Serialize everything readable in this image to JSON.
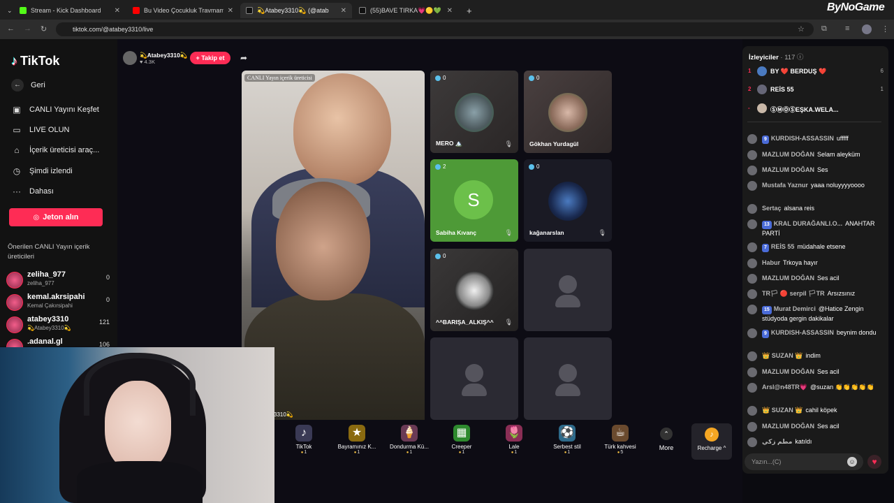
{
  "browser": {
    "tabs": [
      {
        "title": "Stream - Kick Dashboard",
        "favicon_color": "#53fc18"
      },
      {
        "title": "Bu Video Çocukluk Travmamdı",
        "favicon_color": "#ff0000"
      },
      {
        "title": "💫Atabey3310💫 (@atab",
        "favicon_color": "#111111"
      },
      {
        "title": "(55)BAVE TIRKA💗🟡💚 (@k.c",
        "favicon_color": "#111111"
      }
    ],
    "url": "tiktok.com/@atabey3310/live",
    "watermark": "ByNoGame"
  },
  "sidebar": {
    "logo": "TikTok",
    "back": "Geri",
    "items": [
      {
        "label": "CANLI Yayını Keşfet",
        "icon": "tv-icon"
      },
      {
        "label": "LIVE OLUN",
        "icon": "camera-icon"
      },
      {
        "label": "İçerik üreticisi araç...",
        "icon": "home-icon"
      },
      {
        "label": "Şimdi izlendi",
        "icon": "history-icon"
      },
      {
        "label": "Dahası",
        "icon": "more-icon"
      }
    ],
    "jeton_button": "Jeton alın",
    "suggest_title": "Önerilen CANLI Yayın içerik üreticileri",
    "suggestions": [
      {
        "name": "zeliha_977",
        "sub": "zeliha_977",
        "count": "0"
      },
      {
        "name": "kemal.akrsipahi",
        "sub": "Kemal Çakırsipahi",
        "count": "0"
      },
      {
        "name": "atabey3310",
        "sub": "💫Atabey3310💫",
        "count": "121"
      },
      {
        "name": ".adanal.gl",
        "sub": "",
        "count": "106"
      }
    ]
  },
  "live": {
    "host_name": "💫Atabey3310💫",
    "host_likes": "♥ 4.3K",
    "follow_label": "+ Takip et",
    "stage_label": "CANLI Yayın içerik üreticisi",
    "stage_caption": "3310💫",
    "guests": [
      {
        "name": "MERO 🏔️",
        "count": "0"
      },
      {
        "name": "Gökhan Yurdagül",
        "count": "0"
      },
      {
        "name": "Sabiha Kıvanç",
        "count": "2",
        "initial": "S"
      },
      {
        "name": "kağanarslan",
        "count": "0"
      },
      {
        "name": "^^BARIŞA_ALKIŞ^^",
        "count": "0"
      }
    ]
  },
  "gifts": [
    {
      "name": "TikTok",
      "price": "1",
      "icon": "♪",
      "color": "#3a3a55"
    },
    {
      "name": "Bayramınız K...",
      "price": "1",
      "icon": "★",
      "color": "#8a6a10"
    },
    {
      "name": "Dondurma Kü...",
      "price": "1",
      "icon": "🍦",
      "color": "#6a3a55"
    },
    {
      "name": "Creeper",
      "price": "1",
      "icon": "▦",
      "color": "#2e8a2e"
    },
    {
      "name": "Lale",
      "price": "1",
      "icon": "🌷",
      "color": "#8a2e55"
    },
    {
      "name": "Serbest stil",
      "price": "1",
      "icon": "⚽",
      "color": "#2e6a8a"
    },
    {
      "name": "Türk kahvesi",
      "price": "5",
      "icon": "☕",
      "color": "#6a4a2e"
    }
  ],
  "more_label": "More",
  "recharge_label": "Recharge ^",
  "chat": {
    "viewers_title": "İzleyiciler",
    "viewers_count": "· 117",
    "top_viewers": [
      {
        "rank": "1",
        "name": "BY ❤️ BERDUŞ ❤️",
        "score": "6"
      },
      {
        "rank": "2",
        "name": "REİS 55",
        "score": "1"
      },
      {
        "rank": "-",
        "name": "ⓈⓂⓄⓈEŞKA.WELA...",
        "score": ""
      }
    ],
    "messages": [
      {
        "level": "9",
        "user": "KURDISH-ASSASSIN",
        "text": "ufffff"
      },
      {
        "level": "",
        "user": "MAZLUM DOĞAN",
        "text": "Selam aleyküm"
      },
      {
        "level": "",
        "user": "MAZLUM DOĞAN",
        "text": "Ses"
      },
      {
        "level": "",
        "user": "Mustafa Yaznur",
        "text": "yaaa noluyyyyoooo"
      },
      {
        "level": "",
        "user": "Sertaç",
        "text": "alsana reis"
      },
      {
        "level": "13",
        "user": "KRAL DURAĞANLI.O...",
        "text": "ANAHTAR PARTİ"
      },
      {
        "level": "7",
        "user": "REİS 55",
        "text": "müdahale etsene"
      },
      {
        "level": "",
        "user": "Habur",
        "text": "Trkoya hayır"
      },
      {
        "level": "",
        "user": "MAZLUM DOĞAN",
        "text": "Ses acil"
      },
      {
        "level": "",
        "user": "TR🏳 🔴 serpil 🏳TR",
        "text": "Arsızsınız"
      },
      {
        "level": "15",
        "user": "Murat Demirci",
        "text": "@Hatice Zengin stüdyoda gergin dakikalar"
      },
      {
        "level": "9",
        "user": "KURDISH-ASSASSIN",
        "text": "beynim dondu"
      },
      {
        "level": "",
        "user": "👑 SUZAN 👑",
        "text": "indim"
      },
      {
        "level": "",
        "user": "MAZLUM DOĞAN",
        "text": "Ses acil"
      },
      {
        "level": "",
        "user": "Arsl@n48TR💗",
        "text": "@suzan 👏👏👏👏👏"
      },
      {
        "level": "",
        "user": "👑 SUZAN 👑",
        "text": "cahil köpek"
      },
      {
        "level": "",
        "user": "MAZLUM DOĞAN",
        "text": "Ses acil"
      },
      {
        "level": "",
        "user": "مطم زکي",
        "text": "katıldı"
      }
    ],
    "input_placeholder": "Yazın...(C)"
  }
}
